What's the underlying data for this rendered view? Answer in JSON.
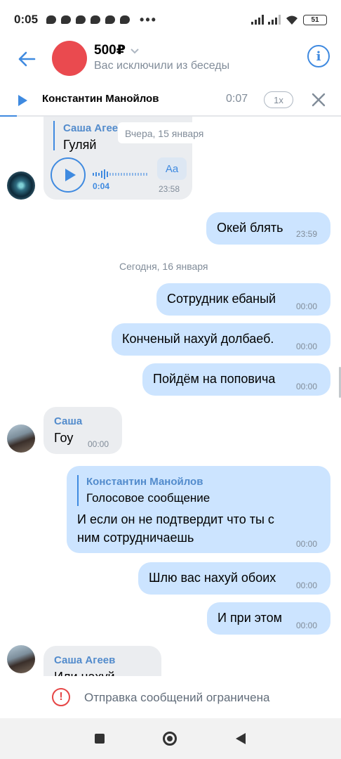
{
  "status_bar": {
    "time": "0:05",
    "more": "•••",
    "battery": "51"
  },
  "header": {
    "title": "500₽",
    "subtitle": "Вас исключили из беседы"
  },
  "player": {
    "name": "Константин Манойлов",
    "time": "0:07",
    "speed": "1x"
  },
  "messages": {
    "first_in": {
      "sender": "Саша Агеев",
      "text": "Гуляй",
      "voice_duration": "0:04",
      "aa_label": "Aa",
      "time": "23:58"
    },
    "yesterday_label": "Вчера, 15 января",
    "out_1": {
      "text": "Окей блять",
      "time": "23:59"
    },
    "today_label": "Сегодня, 16 января",
    "out_2": {
      "text": "Сотрудник ебаный",
      "time": "00:00"
    },
    "out_3": {
      "text": "Конченый нахуй долбаеб.",
      "time": "00:00"
    },
    "out_4": {
      "text": "Пойдём на поповича",
      "time": "00:00"
    },
    "in_2": {
      "sender": "Саша",
      "text": "Гоу",
      "time": "00:00"
    },
    "out_5": {
      "quote_author": "Константин Манойлов",
      "quote_text": "Голосовое сообщение",
      "line1": "И если он не подтвердит что ты с",
      "line2": "ним сотрудничаешь",
      "time": "00:00"
    },
    "out_6": {
      "text": "Шлю вас нахуй обоих",
      "time": "00:00"
    },
    "out_7": {
      "text": "И при этом",
      "time": "00:00"
    },
    "in_3": {
      "sender": "Саша Агеев",
      "text": "Или нахуй"
    }
  },
  "restricted": {
    "icon": "!",
    "text": "Отправка сообщений ограничена"
  },
  "colors": {
    "accent": "#3f8ae0",
    "out_bubble": "#cce4ff",
    "in_bubble": "#ebedf0",
    "chat_avatar": "#ea4a4f",
    "danger": "#e64646"
  },
  "icons": [
    "back-arrow-icon",
    "chevron-down-icon",
    "info-icon",
    "play-icon",
    "close-icon",
    "alert-icon"
  ]
}
